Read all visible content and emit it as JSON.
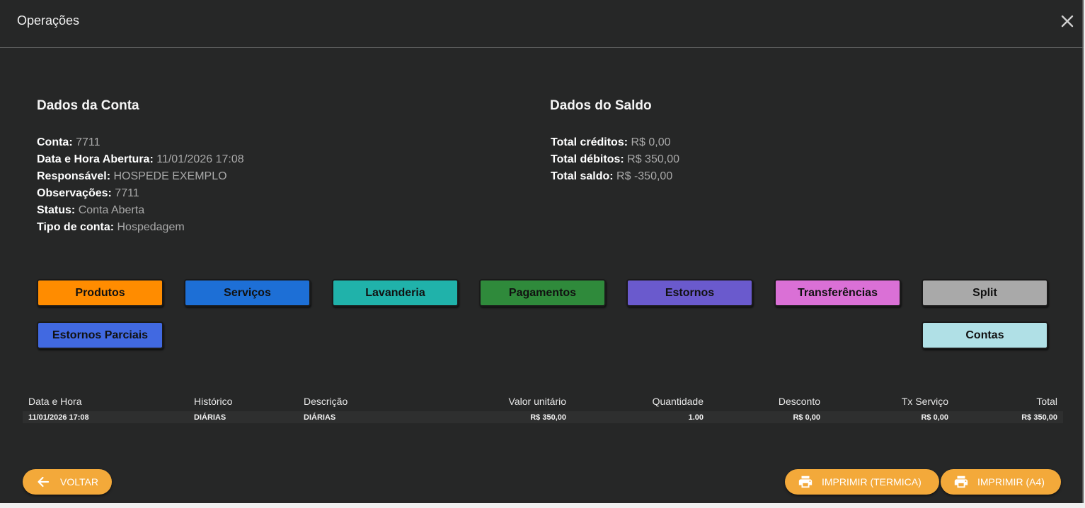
{
  "header": {
    "title": "Operações",
    "close_icon": "close-icon"
  },
  "account": {
    "title": "Dados da Conta",
    "fields": [
      {
        "label": "Conta:",
        "value": "7711"
      },
      {
        "label": "Data e Hora Abertura:",
        "value": "11/01/2026 17:08"
      },
      {
        "label": "Responsável:",
        "value": "HOSPEDE EXEMPLO"
      },
      {
        "label": "Observações:",
        "value": "7711"
      },
      {
        "label": "Status:",
        "value": "Conta Aberta"
      },
      {
        "label": "Tipo de conta:",
        "value": "Hospedagem"
      }
    ]
  },
  "balance": {
    "title": "Dados do Saldo",
    "fields": [
      {
        "label": "Total créditos:",
        "value": "R$ 0,00"
      },
      {
        "label": "Total débitos:",
        "value": "R$ 350,00"
      },
      {
        "label": "Total saldo:",
        "value": "R$ -350,00"
      }
    ]
  },
  "operations": {
    "buttons": [
      {
        "label": "Produtos",
        "color": "#ff8c00"
      },
      {
        "label": "Serviços",
        "color": "#1d6fd6"
      },
      {
        "label": "Lavanderia",
        "color": "#20b2aa"
      },
      {
        "label": "Pagamentos",
        "color": "#2f8a3b"
      },
      {
        "label": "Estornos",
        "color": "#6a5acd"
      },
      {
        "label": "Transferências",
        "color": "#da70d6"
      },
      {
        "label": "Split",
        "color": "#a9a9a9"
      },
      {
        "label": "Estornos Parciais",
        "color": "#4169e1"
      },
      {
        "label": "Contas",
        "color": "#b0e0e6"
      }
    ]
  },
  "table": {
    "columns": [
      "Data e Hora",
      "Histórico",
      "Descrição",
      "Valor unitário",
      "Quantidade",
      "Desconto",
      "Tx Serviço",
      "Total"
    ],
    "rows": [
      [
        "11/01/2026 17:08",
        "DIÁRIAS",
        "DIÁRIAS",
        "R$ 350,00",
        "1.00",
        "R$ 0,00",
        "R$ 0,00",
        "R$ 350,00"
      ]
    ]
  },
  "footer": {
    "back_label": "VOLTAR",
    "back_icon": "arrow-left-icon",
    "print_thermal_label": "IMPRIMIR (TERMICA)",
    "print_a4_label": "IMPRIMIR (A4)",
    "print_icon": "printer-icon",
    "accent": "#f3a93a"
  }
}
